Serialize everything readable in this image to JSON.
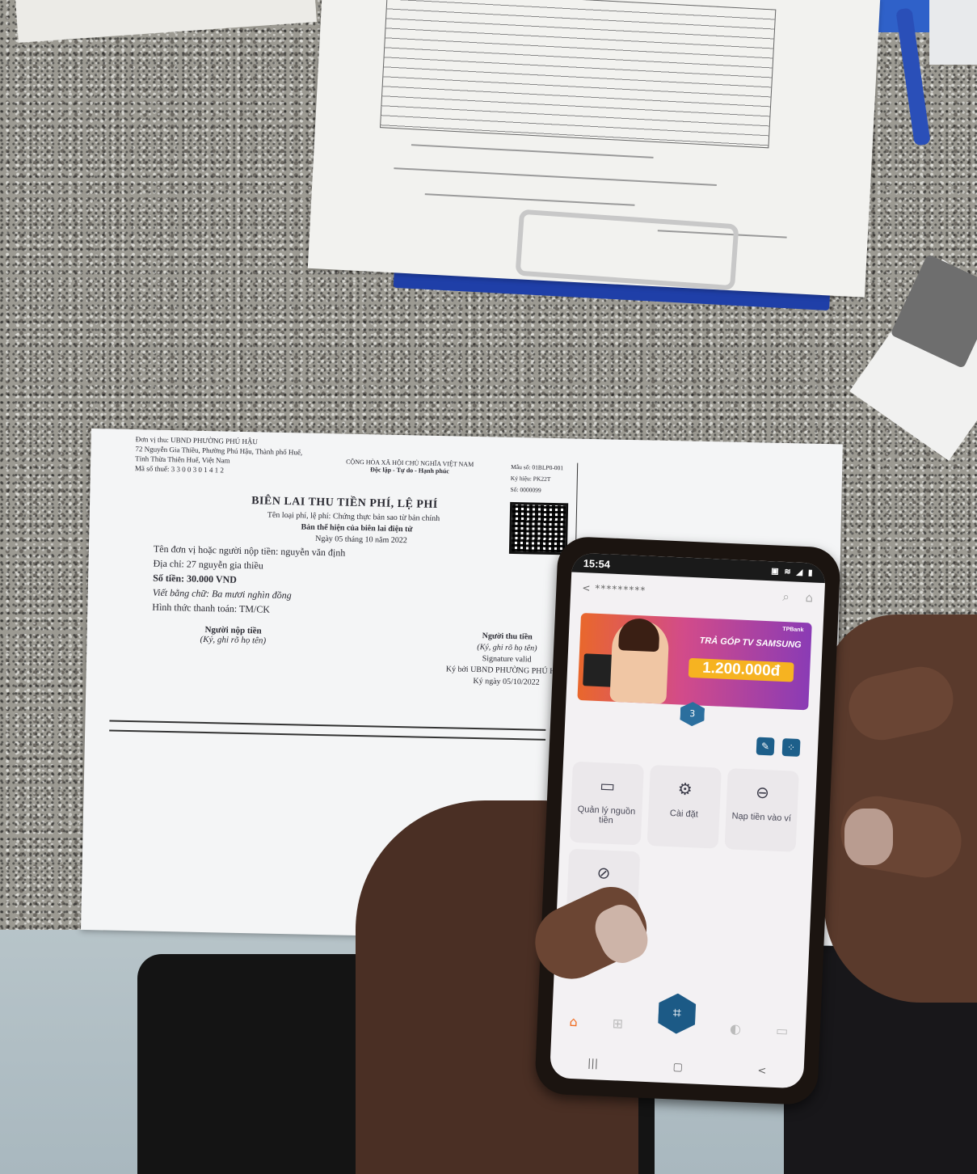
{
  "receipt": {
    "unit_line": "Đơn vị thu: UBND PHƯỜNG PHÚ HẬU",
    "address": "72 Nguyễn Gia Thiều, Phường Phú Hậu, Thành phố Huế,",
    "province": "Tỉnh Thừa Thiên Huế, Việt Nam",
    "tax_code": "Mã số thuế: 3 3 0 0 3 0 1 4 1 2",
    "country_title": "CỘNG HÒA XÃ HỘI CHỦ NGHĨA VIỆT NAM",
    "motto": "Độc lập - Tự do - Hạnh phúc",
    "template_code": "Mẫu số: 01BLP0-001",
    "series": "Ký hiệu: PK22T",
    "number": "Số: 0000099",
    "title": "BIÊN LAI THU TIỀN PHÍ, LỆ PHÍ",
    "fee_type": "Tên loại phí, lệ phí: Chứng thực bản sao từ bản chính",
    "electronic": "Bản thể hiện của biên lai điện tử",
    "date": "Ngày 05 tháng 10 năm 2022",
    "payer": "Tên đơn vị hoặc người nộp tiền: nguyễn văn định",
    "addr_line": "Địa chỉ: 27 nguyễn gia thiều",
    "amount": "Số tiền: 30.000 VND",
    "amount_words": "Viết bằng chữ: Ba mươi nghìn đồng",
    "payment_method": "Hình thức thanh toán: TM/CK",
    "payer_sign_title": "Người nộp tiền",
    "payer_sign_note": "(Ký, ghi rõ họ tên)",
    "collector_sign_title": "Người thu tiền",
    "collector_sign_note": "(Ký, ghi rõ họ tên)",
    "signature_valid": "Signature valid",
    "signed_by": "Ký bởi UBND PHƯỜNG PHÚ HẬU",
    "signed_date": "Ký ngày 05/10/2022"
  },
  "phone": {
    "time": "15:54",
    "status_icons": "▣ ≋ ◢ ▮",
    "account": "< *********",
    "banner": {
      "brand": "TPBank",
      "headline": "TRẢ GÓP TV SAMSUNG",
      "price": "1.200.000đ"
    },
    "badge": "3",
    "tiles": [
      {
        "icon": "▭",
        "label": "Quản lý nguồn tiền"
      },
      {
        "icon": "⚙",
        "label": "Cài đặt"
      },
      {
        "icon": "⊖",
        "label": "Nạp tiền vào ví"
      },
      {
        "icon": "⊘",
        "label": ""
      }
    ],
    "nav": [
      "|||",
      "▢",
      "<"
    ]
  }
}
